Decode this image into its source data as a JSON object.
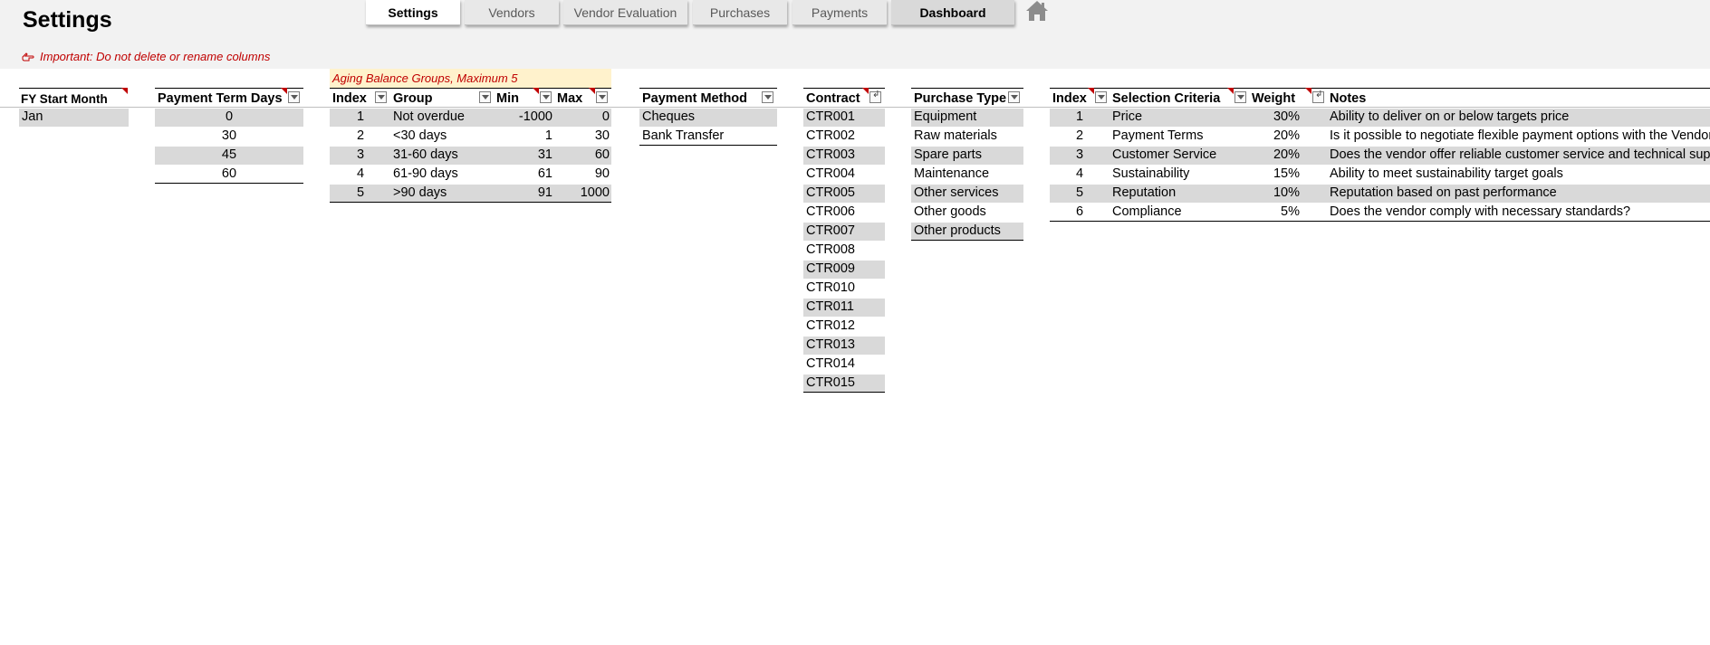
{
  "title": "Settings",
  "warning": "Important: Do not delete or rename columns",
  "nav": [
    {
      "label": "Settings"
    },
    {
      "label": "Vendors"
    },
    {
      "label": "Vendor Evaluation"
    },
    {
      "label": "Purchases"
    },
    {
      "label": "Payments"
    },
    {
      "label": "Dashboard"
    }
  ],
  "fy": {
    "header": "FY Start Month",
    "value": "Jan"
  },
  "payment_terms": {
    "header": "Payment Term Days",
    "values": [
      "0",
      "30",
      "45",
      "60"
    ]
  },
  "aging": {
    "caption": "Aging Balance Groups, Maximum 5",
    "headers": {
      "index": "Index",
      "group": "Group",
      "min": "Min",
      "max": "Max"
    },
    "rows": [
      {
        "index": "1",
        "group": "Not overdue",
        "min": "-1000",
        "max": "0"
      },
      {
        "index": "2",
        "group": "<30 days",
        "min": "1",
        "max": "30"
      },
      {
        "index": "3",
        "group": "31-60 days",
        "min": "31",
        "max": "60"
      },
      {
        "index": "4",
        "group": "61-90 days",
        "min": "61",
        "max": "90"
      },
      {
        "index": "5",
        "group": ">90 days",
        "min": "91",
        "max": "1000"
      }
    ]
  },
  "payment_method": {
    "header": "Payment Method",
    "values": [
      "Cheques",
      "Bank Transfer"
    ]
  },
  "contract": {
    "header": "Contract",
    "values": [
      "CTR001",
      "CTR002",
      "CTR003",
      "CTR004",
      "CTR005",
      "CTR006",
      "CTR007",
      "CTR008",
      "CTR009",
      "CTR010",
      "CTR011",
      "CTR012",
      "CTR013",
      "CTR014",
      "CTR015"
    ]
  },
  "purchase_type": {
    "header": "Purchase Type",
    "values": [
      "Equipment",
      "Raw materials",
      "Spare parts",
      "Maintenance",
      "Other services",
      "Other goods",
      "Other products"
    ]
  },
  "criteria": {
    "headers": {
      "index": "Index",
      "criteria": "Selection Criteria",
      "weight": "Weight",
      "notes": "Notes"
    },
    "rows": [
      {
        "index": "1",
        "criteria": "Price",
        "weight": "30%",
        "notes": "Ability to deliver on or below targets price"
      },
      {
        "index": "2",
        "criteria": "Payment Terms",
        "weight": "20%",
        "notes": "Is it possible to negotiate flexible payment options with the Vendor?"
      },
      {
        "index": "3",
        "criteria": "Customer Service",
        "weight": "20%",
        "notes": "Does the vendor offer reliable customer service and technical support?"
      },
      {
        "index": "4",
        "criteria": "Sustainability",
        "weight": "15%",
        "notes": "Ability to meet sustainability target goals"
      },
      {
        "index": "5",
        "criteria": "Reputation",
        "weight": "10%",
        "notes": "Reputation based on past performance"
      },
      {
        "index": "6",
        "criteria": "Compliance",
        "weight": "5%",
        "notes": "Does the vendor comply with necessary standards?"
      }
    ]
  },
  "colors": {
    "shade": "#d9d9d9",
    "warning": "#c00000",
    "band": "#f2f2f2",
    "caption_bg": "#fff2cc"
  }
}
